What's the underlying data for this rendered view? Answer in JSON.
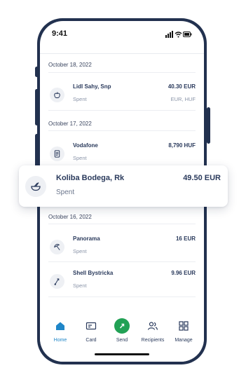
{
  "status_bar": {
    "time": "9:41"
  },
  "groups": [
    {
      "date": "October 18, 2022",
      "items": [
        {
          "name": "Lidl Sahy, Snp",
          "status": "Spent",
          "amount": "40.30 EUR",
          "secondary": "EUR, HUF",
          "icon": "apple-icon"
        }
      ]
    },
    {
      "date": "October 17, 2022",
      "items": [
        {
          "name": "Vodafone",
          "status": "Spent",
          "amount": "8,790 HUF",
          "icon": "receipt-icon"
        }
      ]
    },
    {
      "date": "October 16, 2022",
      "items": [
        {
          "name": "Panorama",
          "status": "Spent",
          "amount": "16 EUR",
          "icon": "umbrella-icon"
        },
        {
          "name": "Shell Bystricka",
          "status": "Spent",
          "amount": "9.96 EUR",
          "icon": "fuel-icon"
        }
      ]
    }
  ],
  "highlight": {
    "name": "Koliba Bodega, Rk",
    "status": "Spent",
    "amount": "49.50 EUR",
    "icon": "bowl-icon"
  },
  "nav": [
    {
      "label": "Home",
      "icon": "home-icon",
      "active": true
    },
    {
      "label": "Card",
      "icon": "card-icon"
    },
    {
      "label": "Send",
      "icon": "send-icon"
    },
    {
      "label": "Recipients",
      "icon": "recipients-icon"
    },
    {
      "label": "Manage",
      "icon": "grid-icon"
    }
  ],
  "colors": {
    "frame": "#22314f",
    "accent": "#1f86c8",
    "send": "#22a155"
  }
}
